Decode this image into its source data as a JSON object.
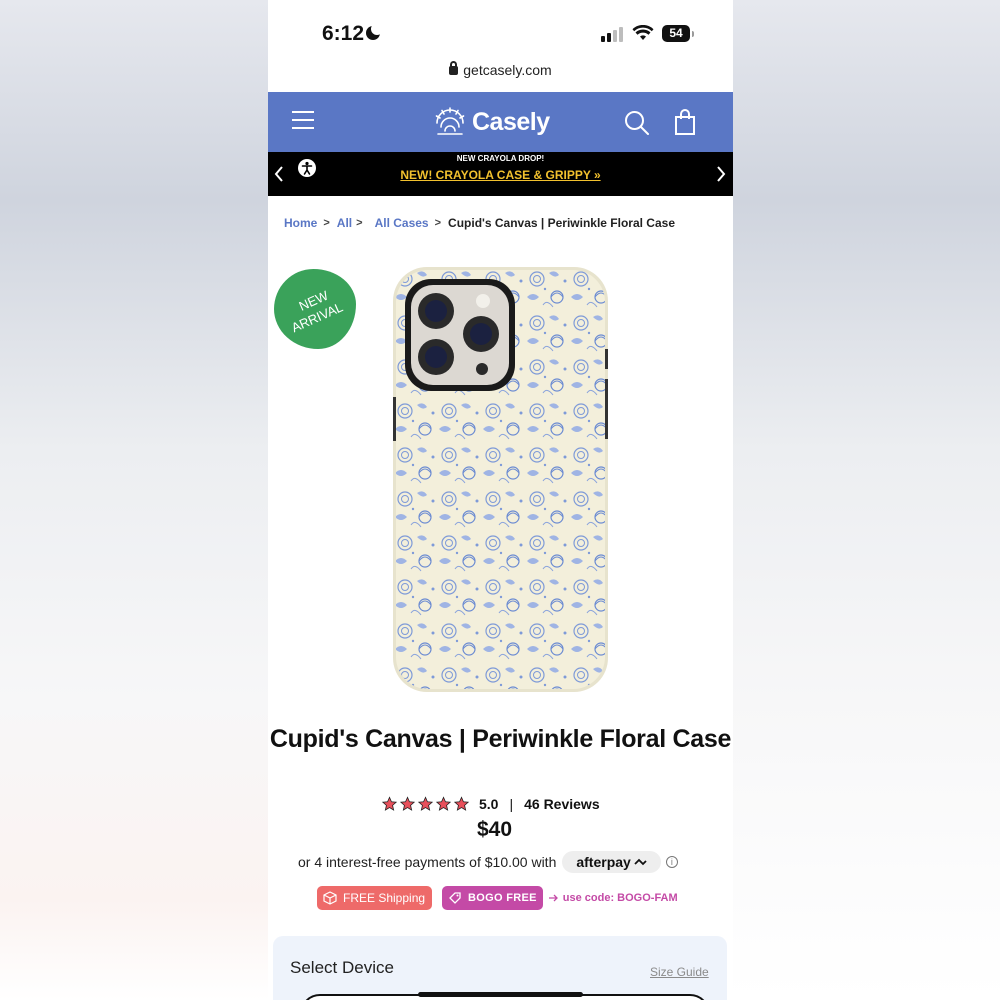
{
  "status_bar": {
    "time": "6:12",
    "battery": "54"
  },
  "browser": {
    "url": "getcasely.com"
  },
  "header": {
    "logo": "Casely",
    "menu_icon": "hamburger-icon",
    "search_icon": "search-icon",
    "cart_icon": "shopping-bag-icon",
    "color": "#5a77c5"
  },
  "promo": {
    "eyebrow": "NEW CRAYOLA DROP!",
    "link": "NEW! CRAYOLA CASE & GRIPPY »",
    "link_color": "#f2c12e"
  },
  "breadcrumb": {
    "home": "Home",
    "all": "All",
    "cases": "All Cases",
    "current": "Cupid's Canvas | Periwinkle Floral Case"
  },
  "product": {
    "badge_line1": "NEW",
    "badge_line2": "ARRIVAL",
    "title": "Cupid's Canvas | Periwinkle Floral Case",
    "rating": "5.0",
    "reviews": "46 Reviews",
    "stars": 5,
    "price": "$40",
    "installment_text": "or 4 interest-free payments of $10.00 with",
    "afterpay_label": "afterpay",
    "info": "i"
  },
  "offers": {
    "shipping": "FREE Shipping",
    "bogo": "BOGO FREE",
    "code": "use code: BOGO-FAM",
    "shipping_color": "#ee6a69",
    "bogo_color": "#c44aa6"
  },
  "device": {
    "label": "Select Device",
    "size_guide": "Size Guide"
  }
}
